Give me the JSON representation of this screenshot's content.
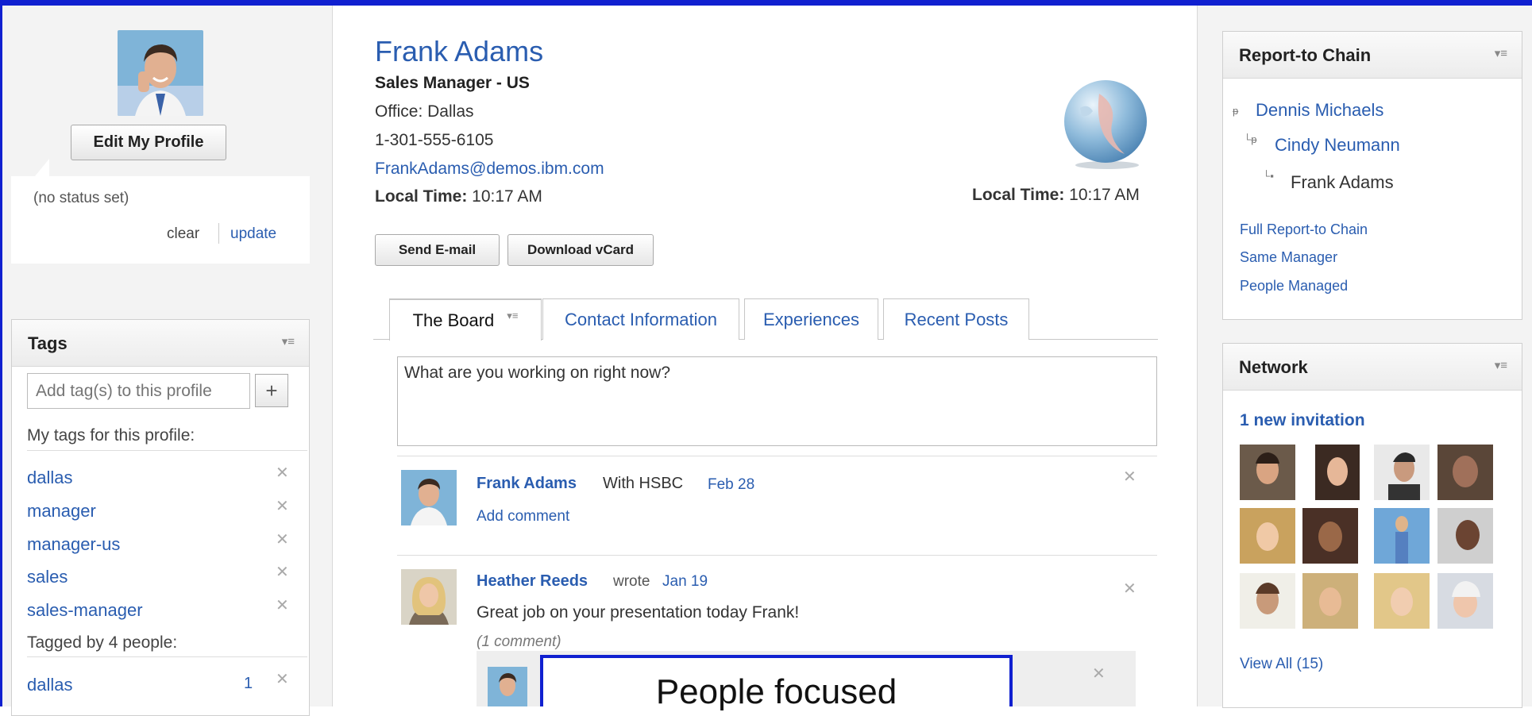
{
  "profile": {
    "name": "Frank Adams",
    "job_title": "Sales Manager - US",
    "office": "Office: Dallas",
    "phone": "1-301-555-6105",
    "email": "FrankAdams@demos.ibm.com",
    "local_time_label": "Local Time:",
    "local_time_value": "10:17 AM",
    "edit_button": "Edit My Profile",
    "status": "(no status set)",
    "status_clear": "clear",
    "status_update": "update",
    "send_email": "Send E-mail",
    "download_vcard": "Download vCard"
  },
  "tags_panel": {
    "title": "Tags",
    "input_placeholder": "Add tag(s) to this profile",
    "my_tags_label": "My tags for this profile:",
    "my_tags": [
      "dallas",
      "manager",
      "manager-us",
      "sales",
      "sales-manager"
    ],
    "tagged_by_label": "Tagged by 4 people:",
    "tagged_by": [
      {
        "tag": "dallas",
        "count": "1"
      }
    ]
  },
  "tabs": [
    {
      "label": "The Board",
      "active": true
    },
    {
      "label": "Contact Information",
      "active": false
    },
    {
      "label": "Experiences",
      "active": false
    },
    {
      "label": "Recent Posts",
      "active": false
    }
  ],
  "board": {
    "composer_placeholder": "What are you working on right now?",
    "entries": [
      {
        "author": "Frank Adams",
        "text": "With HSBC",
        "date": "Feb 28",
        "action": "Add comment"
      },
      {
        "author": "Heather Reeds",
        "wrote": "wrote",
        "date": "Jan 19",
        "text": "Great job on your presentation today Frank!",
        "comments": "(1 comment)"
      }
    ],
    "callout": "People focused"
  },
  "report_chain": {
    "title": "Report-to Chain",
    "chain": [
      "Dennis Michaels",
      "Cindy Neumann",
      "Frank Adams"
    ],
    "links": [
      "Full Report-to Chain",
      "Same Manager",
      "People Managed"
    ]
  },
  "network": {
    "title": "Network",
    "invitation": "1 new invitation",
    "view_all": "View All (15)"
  },
  "icons": {
    "panel_menu": "panel-menu-icon",
    "remove": "close-icon",
    "add": "plus-icon",
    "globe": "globe-icon"
  },
  "colors": {
    "link": "#2a5db0",
    "frame": "#1020d0"
  }
}
